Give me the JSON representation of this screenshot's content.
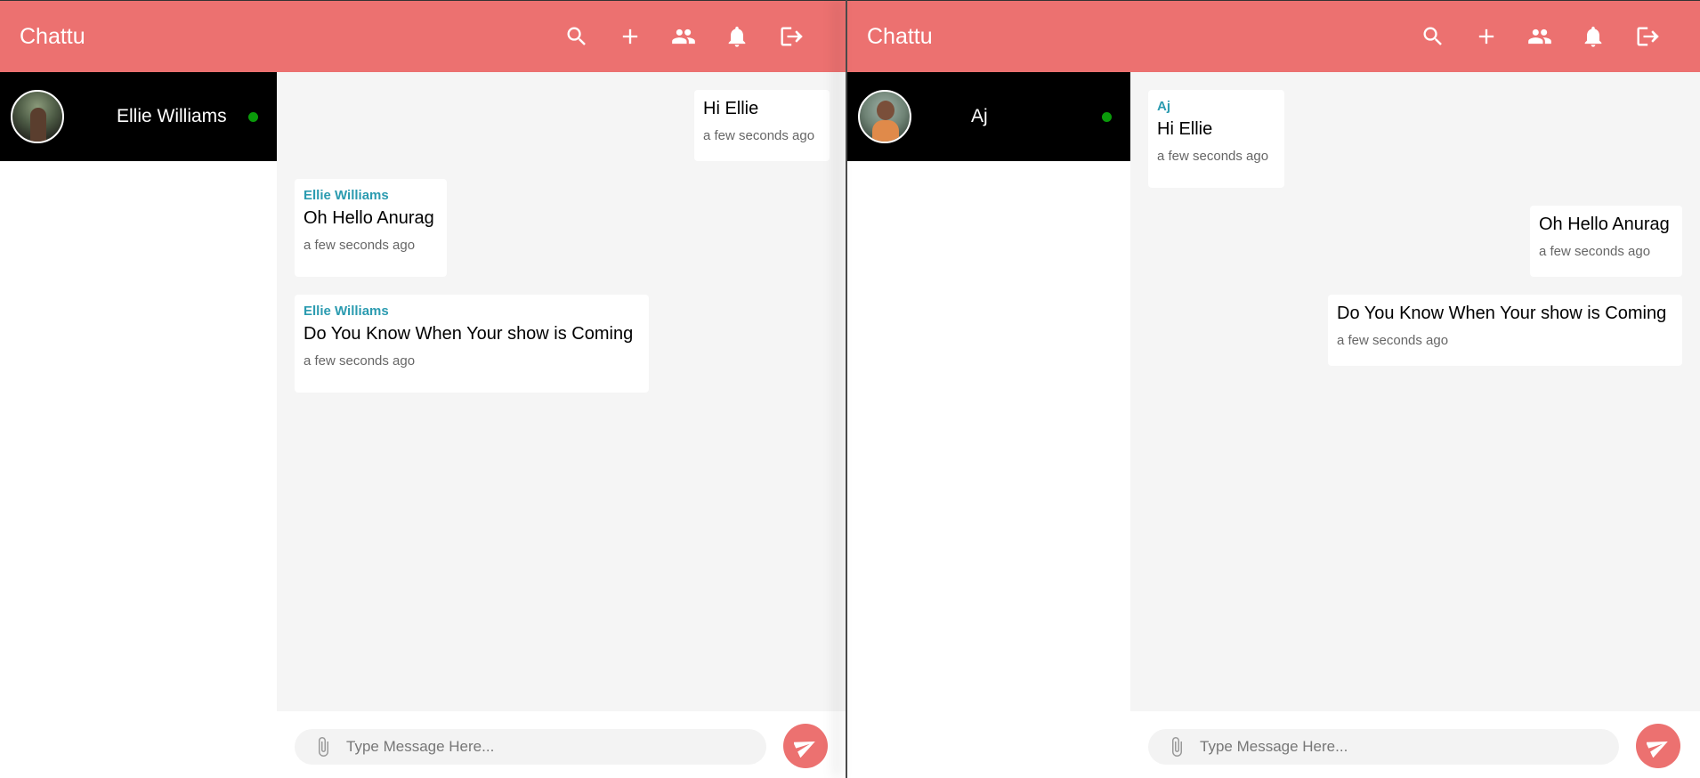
{
  "colors": {
    "accent": "#ec7170",
    "sender_name": "#2b9bb0",
    "online": "#0a9a0a",
    "chat_bg": "#f5f5f5",
    "contact_bg": "#000000"
  },
  "icons": [
    "search-icon",
    "plus-icon",
    "group-icon",
    "bell-icon",
    "logout-icon",
    "paperclip-icon",
    "send-icon"
  ],
  "left_window": {
    "app_title": "Chattu",
    "contact": {
      "name": "Ellie Williams",
      "status": "online"
    },
    "messages": [
      {
        "direction": "outgoing",
        "sender": "",
        "text": "Hi Ellie",
        "time": "a few seconds ago"
      },
      {
        "direction": "incoming",
        "sender": "Ellie Williams",
        "text": "Oh Hello Anurag",
        "time": "a few seconds ago"
      },
      {
        "direction": "incoming",
        "sender": "Ellie Williams",
        "text": "Do You Know When Your show is Coming",
        "time": "a few seconds ago"
      }
    ],
    "composer": {
      "placeholder": "Type Message Here...",
      "value": ""
    }
  },
  "right_window": {
    "app_title": "Chattu",
    "contact": {
      "name": "Aj",
      "status": "online"
    },
    "messages": [
      {
        "direction": "incoming",
        "sender": "Aj",
        "text": "Hi Ellie",
        "time": "a few seconds ago"
      },
      {
        "direction": "outgoing",
        "sender": "",
        "text": "Oh Hello Anurag",
        "time": "a few seconds ago"
      },
      {
        "direction": "outgoing",
        "sender": "",
        "text": "Do You Know When Your show is Coming",
        "time": "a few seconds ago"
      }
    ],
    "composer": {
      "placeholder": "Type Message Here...",
      "value": ""
    }
  }
}
